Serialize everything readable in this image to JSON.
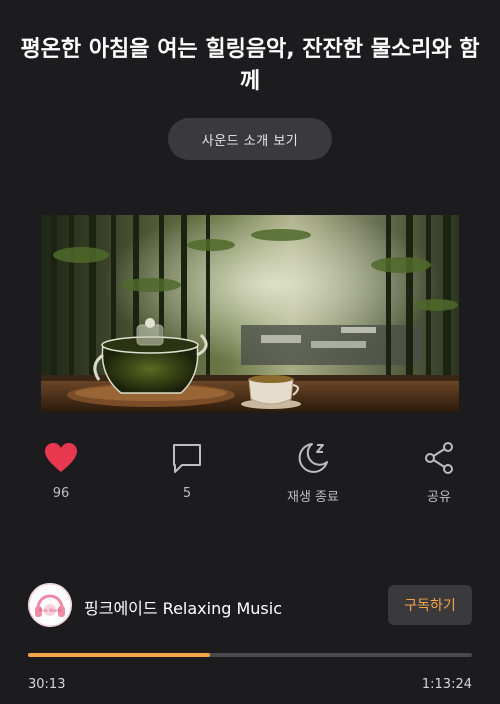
{
  "video": {
    "title": "평온한 아침을 여는 힐링음악, 잔잔한 물소리와 함께",
    "intro_button_label": "사운드 소개 보기",
    "artwork_icon": "teapot-bamboo-artwork"
  },
  "actions": {
    "like": {
      "icon": "heart-icon",
      "label": "96",
      "color": "#e8384f"
    },
    "comments": {
      "icon": "comment-icon",
      "label": "5"
    },
    "sleep_timer": {
      "icon": "moon-sleep-icon",
      "label": "재생 종료"
    },
    "share": {
      "icon": "share-icon",
      "label": "공유"
    }
  },
  "channel": {
    "avatar_icon": "headphones-avatar-icon",
    "avatar_text": "Pink Made",
    "name": "핑크에이드 Relaxing Music",
    "subscribe_label": "구독하기"
  },
  "playback": {
    "elapsed": "30:13",
    "duration": "1:13:24",
    "progress_fraction": 0.41
  },
  "colors": {
    "background": "#1c1c1e",
    "accent": "#f5a54a",
    "like": "#e8384f"
  }
}
